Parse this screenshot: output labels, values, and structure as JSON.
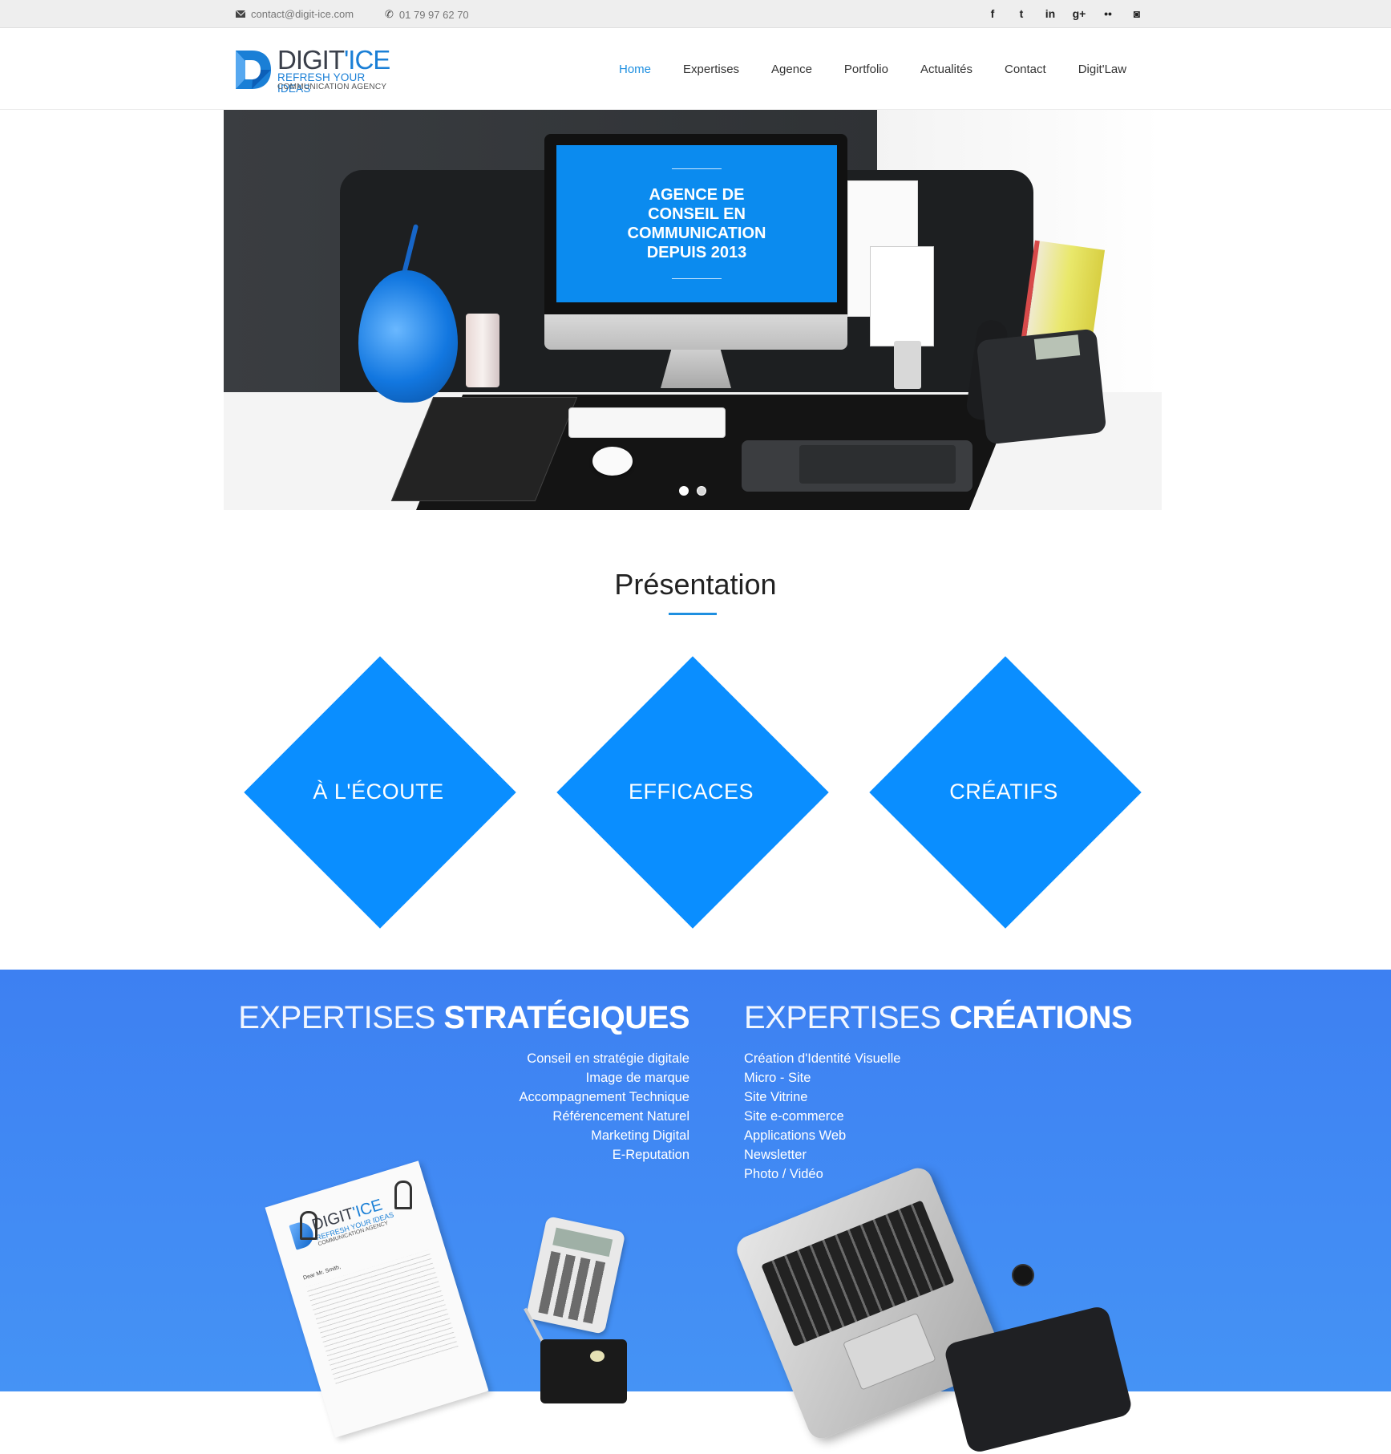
{
  "topbar": {
    "email": "contact@digit-ice.com",
    "phone": "01 79 97 62 70",
    "social": [
      {
        "icon": "facebook-icon",
        "glyph": "f"
      },
      {
        "icon": "twitter-icon",
        "glyph": "t"
      },
      {
        "icon": "linkedin-icon",
        "glyph": "in"
      },
      {
        "icon": "google-plus-icon",
        "glyph": "g+"
      },
      {
        "icon": "flickr-icon",
        "glyph": "••"
      },
      {
        "icon": "instagram-icon",
        "glyph": "◙"
      }
    ]
  },
  "header": {
    "logo": {
      "brand_a": "DIGIT",
      "brand_b": "'ICE",
      "tagline": "REFRESH YOUR IDEAS",
      "subtagline": "COMMUNICATION AGENCY"
    },
    "nav": [
      {
        "label": "Home",
        "active": true
      },
      {
        "label": "Expertises",
        "active": false
      },
      {
        "label": "Agence",
        "active": false
      },
      {
        "label": "Portfolio",
        "active": false
      },
      {
        "label": "Actualités",
        "active": false
      },
      {
        "label": "Contact",
        "active": false
      },
      {
        "label": "Digit'Law",
        "active": false
      }
    ]
  },
  "hero": {
    "title": "AGENCE DE\nCONSEIL EN\nCOMMUNICATION\nDEPUIS 2013",
    "slides": 2,
    "active_slide": 1
  },
  "presentation": {
    "title": "Présentation",
    "values": [
      "À L'ÉCOUTE",
      "EFFICACES",
      "CRÉATIFS"
    ]
  },
  "expertises": {
    "strategic": {
      "title_light": "EXPERTISES",
      "title_bold": "STRATÉGIQUES",
      "items": [
        "Conseil en stratégie digitale",
        "Image de marque",
        "Accompagnement Technique",
        "Référencement Naturel",
        "Marketing Digital",
        "E-Reputation"
      ]
    },
    "creative": {
      "title_light": "EXPERTISES",
      "title_bold": "CRÉATIONS",
      "items": [
        "Création d'Identité Visuelle",
        "Micro - Site",
        "Site Vitrine",
        "Site e-commerce",
        "Applications Web",
        "Newsletter",
        "Photo / Vidéo"
      ]
    }
  },
  "props": {
    "letter_brand_a": "DIGIT",
    "letter_brand_b": "'ICE",
    "letter_tagline": "REFRESH YOUR IDEAS",
    "letter_subtagline": "COMMUNICATION AGENCY",
    "letter_greeting": "Dear Mr. Smith,"
  },
  "colors": {
    "accent": "#1e8fe0",
    "diamond": "#0a8eff",
    "section_blue": "#3d80f2"
  }
}
